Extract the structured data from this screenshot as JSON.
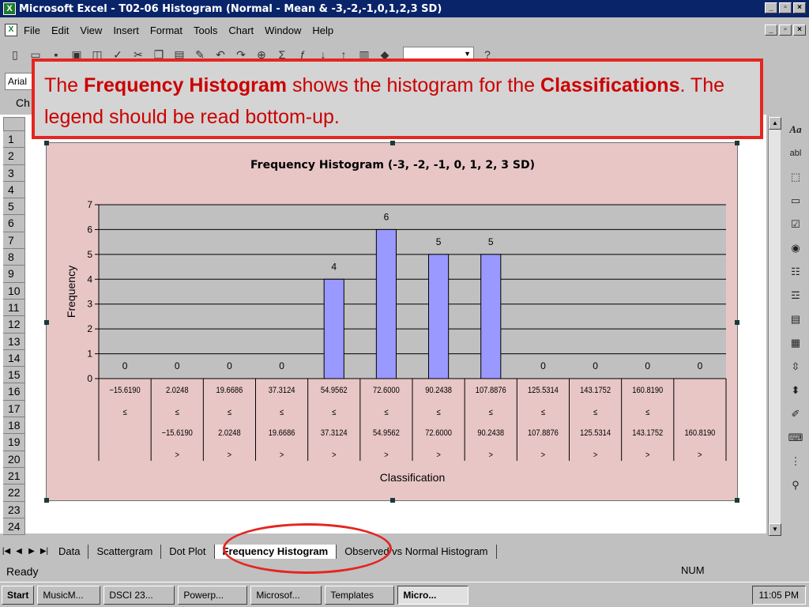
{
  "window": {
    "title": "Microsoft Excel - T02-06 Histogram (Normal - Mean & -3,-2,-1,0,1,2,3 SD)",
    "controls": [
      "_",
      "▫",
      "×"
    ]
  },
  "menu": {
    "items": [
      "File",
      "Edit",
      "View",
      "Insert",
      "Format",
      "Tools",
      "Chart",
      "Window",
      "Help"
    ]
  },
  "toolbar": {
    "icons": [
      "new-icon",
      "open-icon",
      "save-icon",
      "print-icon",
      "preview-icon",
      "spelling-icon",
      "cut-icon",
      "copy-icon",
      "paste-icon",
      "format-painter-icon",
      "undo-icon",
      "redo-icon",
      "hyperlink-icon",
      "autosum-icon",
      "function-icon",
      "sort-asc-icon",
      "sort-desc-icon",
      "chart-wizard-icon",
      "drawing-icon",
      "help-icon"
    ]
  },
  "formatting": {
    "font_name": "Arial"
  },
  "namebox": {
    "text": "Ch"
  },
  "rows": [
    "1",
    "2",
    "3",
    "4",
    "5",
    "6",
    "7",
    "8",
    "9",
    "10",
    "11",
    "12",
    "13",
    "14",
    "15",
    "16",
    "17",
    "18",
    "19",
    "20",
    "21",
    "22",
    "23",
    "24"
  ],
  "callout": {
    "part1": "The ",
    "bold1": "Frequency Histogram",
    "part2": " shows the histogram for the ",
    "bold2": "Classifications",
    "part3": ".  The legend should be read bottom-up."
  },
  "chart_data": {
    "type": "bar",
    "title": "Frequency Histogram (-3, -2, -1, 0, 1, 2, 3 SD)",
    "xlabel": "Classification",
    "ylabel": "Frequency",
    "ylim": [
      0,
      7
    ],
    "yticks": [
      0,
      1,
      2,
      3,
      4,
      5,
      6,
      7
    ],
    "grid": true,
    "categories": [
      [
        "−15.6190",
        "≤",
        "",
        "",
        ""
      ],
      [
        "2.0248",
        "≤",
        "−15.6190",
        ">",
        ""
      ],
      [
        "19.6686",
        "≤",
        "2.0248",
        ">",
        ""
      ],
      [
        "37.3124",
        "≤",
        "19.6686",
        ">",
        ""
      ],
      [
        "54.9562",
        "≤",
        "37.3124",
        ">",
        ""
      ],
      [
        "72.6000",
        "≤",
        "54.9562",
        ">",
        ""
      ],
      [
        "90.2438",
        "≤",
        "72.6000",
        ">",
        ""
      ],
      [
        "107.8876",
        "≤",
        "90.2438",
        ">",
        ""
      ],
      [
        "125.5314",
        "≤",
        "107.8876",
        ">",
        ""
      ],
      [
        "143.1752",
        "≤",
        "125.5314",
        ">",
        ""
      ],
      [
        "160.8190",
        "≤",
        "143.1752",
        ">",
        ""
      ],
      [
        "",
        "",
        "160.8190",
        ">",
        ""
      ]
    ],
    "values": [
      0,
      0,
      0,
      0,
      4,
      6,
      5,
      5,
      0,
      0,
      0,
      0
    ],
    "colors": {
      "bar": "#9999ff",
      "plot_bg": "#c0c0c0",
      "chart_bg": "#e8c6c6"
    }
  },
  "right_toolbar": {
    "icons": [
      "label-icon",
      "edit-box-icon",
      "group-box-icon",
      "button-icon",
      "checkbox-icon",
      "option-button-icon",
      "list-box-icon",
      "combo-box-icon",
      "combo-list-edit-icon",
      "combo-dropdown-edit-icon",
      "scroll-bar-icon",
      "spinner-icon",
      "control-properties-icon",
      "edit-code-icon",
      "toggle-grid-icon",
      "run-dialog-icon"
    ],
    "label_text": "Aa",
    "edit_text": "abl"
  },
  "tabs": {
    "items": [
      "Data",
      "Scattergram",
      "Dot Plot",
      "Frequency Histogram",
      "Observed vs Normal Histogram"
    ],
    "active": "Frequency Histogram"
  },
  "status": {
    "text": "Ready",
    "num": "NUM"
  },
  "taskbar": {
    "start": "Start",
    "buttons": [
      "MusicM...",
      "DSCI 23...",
      "Powerp...",
      "Microsof...",
      "Templates",
      "Micro..."
    ],
    "time": "11:05 PM"
  }
}
